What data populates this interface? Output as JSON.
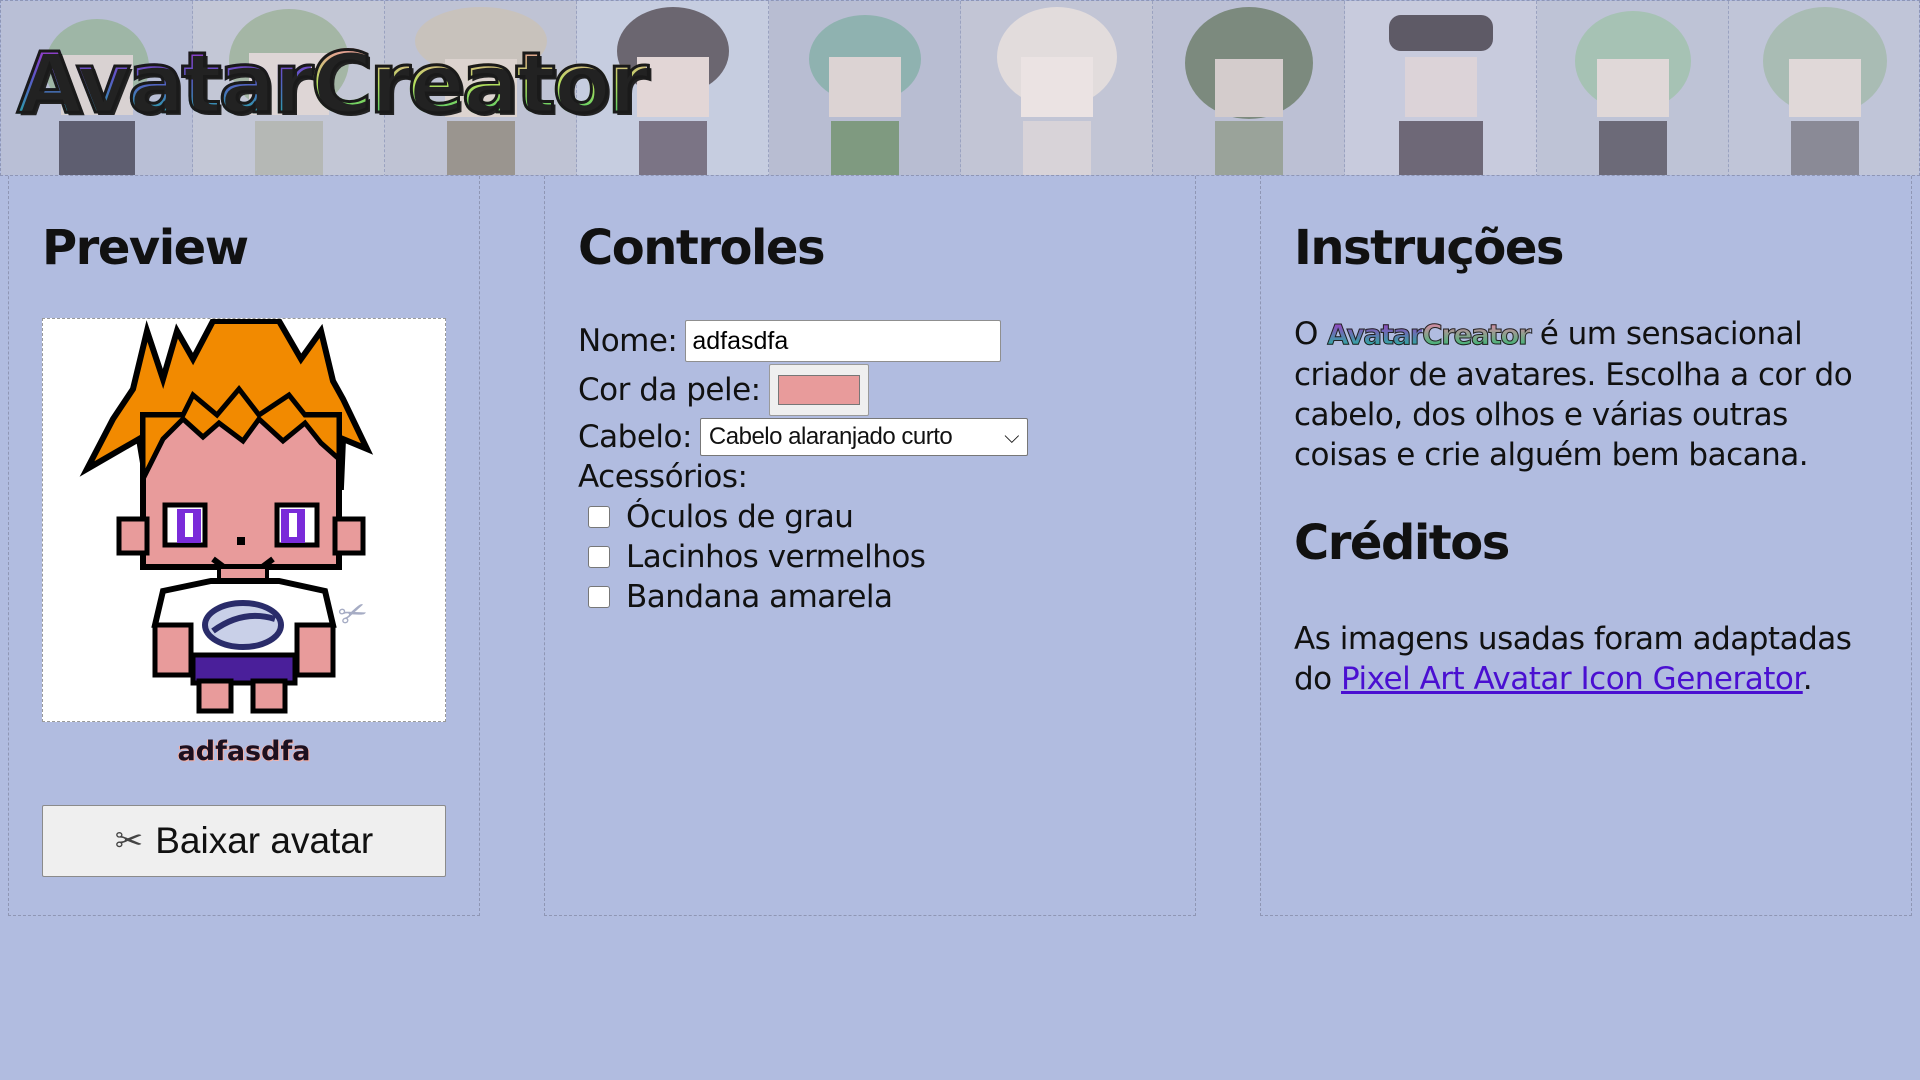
{
  "header": {
    "logo_part1": "Avatar",
    "logo_part2": "Creator"
  },
  "preview": {
    "title": "Preview",
    "avatar_name": "adfasdfa",
    "download_label": "Baixar avatar"
  },
  "controls": {
    "title": "Controles",
    "name_label": "Nome:",
    "name_value": "adfasdfa",
    "skin_label": "Cor da pele:",
    "skin_color": "#e89b9b",
    "hair_label": "Cabelo:",
    "hair_selected": "Cabelo alaranjado curto",
    "accessories_label": "Acessórios:",
    "accessories": [
      {
        "label": "Óculos de grau",
        "checked": false
      },
      {
        "label": "Lacinhos vermelhos",
        "checked": false
      },
      {
        "label": "Bandana amarela",
        "checked": false
      }
    ]
  },
  "instructions": {
    "title": "Instruções",
    "text_prefix": "O",
    "text_body": "é um sensacional criador de avatares. Escolha a cor do cabelo, dos olhos e várias outras coisas e crie alguém bem bacana.",
    "credits_title": "Créditos",
    "credits_text": "As imagens usadas foram adaptadas do",
    "credits_link": "Pixel Art Avatar Icon Generator",
    "credits_suffix": "."
  },
  "colors": {
    "background": "#b1bce0",
    "hair": "#f28a00",
    "eyes": "#7a2bd9",
    "link": "#4a0fd1"
  }
}
